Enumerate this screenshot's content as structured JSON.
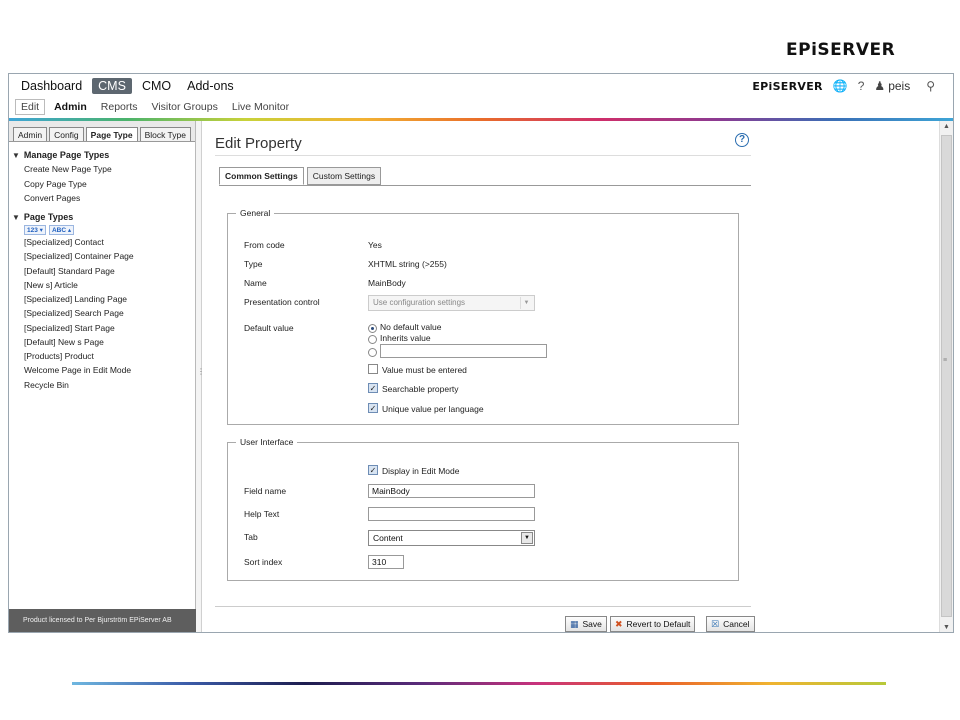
{
  "brand": "EPiSERVER",
  "global_nav": {
    "items": [
      "Dashboard",
      "CMS",
      "CMO",
      "Add-ons"
    ],
    "active": "CMS",
    "subitems": [
      "Edit",
      "Admin",
      "Reports",
      "Visitor Groups",
      "Live Monitor"
    ],
    "user": "peis",
    "icons": [
      "globe-icon",
      "help-icon",
      "user-icon",
      "search-icon"
    ]
  },
  "left": {
    "tabs": [
      "Admin",
      "Config",
      "Page Type",
      "Block Type"
    ],
    "active_tab": "Page Type",
    "section1": {
      "title": "Manage Page Types",
      "items": [
        "Create New Page Type",
        "Copy Page Type",
        "Convert Pages"
      ]
    },
    "section2": {
      "title": "Page Types",
      "sort_icons": [
        "123",
        "ABC"
      ],
      "items": [
        "[Specialized] Contact",
        "[Specialized] Container Page",
        "[Default] Standard Page",
        "[New s] Article",
        "[Specialized] Landing Page",
        "[Specialized] Search Page",
        "[Specialized] Start Page",
        "[Default] New s Page",
        "[Products] Product",
        "Welcome Page in Edit Mode",
        "Recycle Bin"
      ]
    },
    "license": "Product licensed to Per Bjurström EPiServer AB"
  },
  "main": {
    "title": "Edit Property",
    "tabs": [
      "Common Settings",
      "Custom Settings"
    ],
    "active_tab": "Common Settings",
    "general": {
      "legend": "General",
      "from_code_label": "From code",
      "from_code_value": "Yes",
      "type_label": "Type",
      "type_value": "XHTML string (>255)",
      "name_label": "Name",
      "name_value": "MainBody",
      "presentation_label": "Presentation control",
      "presentation_value": "Use configuration settings",
      "default_label": "Default value",
      "default_options": [
        "No default value",
        "Inherits value"
      ],
      "default_selected": "No default value",
      "custom_default": "",
      "must_enter_label": "Value must be entered",
      "must_enter": false,
      "searchable_label": "Searchable property",
      "searchable": true,
      "unique_label": "Unique value per language",
      "unique": true
    },
    "ui": {
      "legend": "User Interface",
      "display_label": "Display in Edit Mode",
      "display": true,
      "field_name_label": "Field name",
      "field_name_value": "MainBody",
      "help_text_label": "Help Text",
      "help_text_value": "",
      "tab_label": "Tab",
      "tab_value": "Content",
      "sort_label": "Sort index",
      "sort_value": "310"
    },
    "buttons": {
      "save": "Save",
      "revert": "Revert to Default",
      "cancel": "Cancel"
    }
  },
  "colors": {
    "active_nav": "#5d6770",
    "license_bar": "#5e5e5e",
    "link_blue": "#2a6db0"
  }
}
